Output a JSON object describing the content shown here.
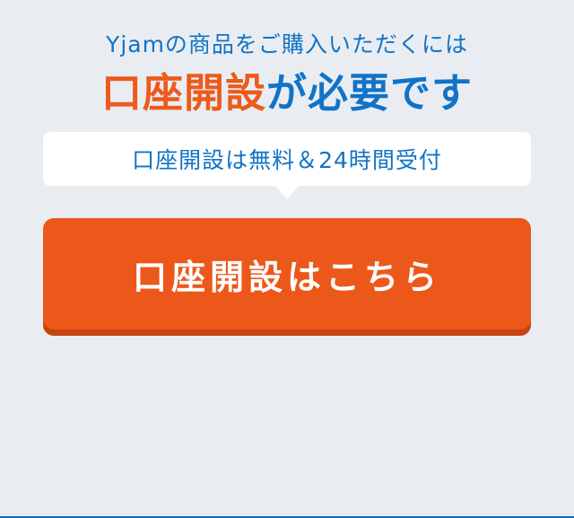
{
  "intro": {
    "text": "Yjamの商品をご購入いただくには"
  },
  "headline": {
    "accent": "口座開設",
    "rest": "が必要です"
  },
  "bubble": {
    "text": "口座開設は無料＆24時間受付"
  },
  "cta": {
    "label": "口座開設はこちら"
  },
  "colors": {
    "background": "#e9edf2",
    "blue": "#1273c6",
    "orange": "#ec581a",
    "orange_shadow": "#c54410",
    "white": "#ffffff"
  }
}
